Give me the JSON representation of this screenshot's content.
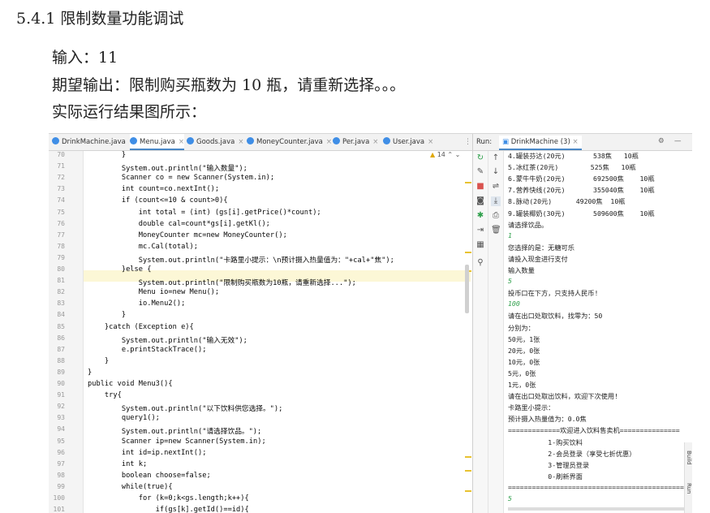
{
  "heading": "5.4.1 限制数量功能调试",
  "input_line": "输入：11",
  "expected_line": "期望输出：限制购买瓶数为 10 瓶，请重新选择。。。",
  "actual_line": "实际运行结果图所示：",
  "ide": {
    "tabs": [
      "DrinkMachine.java",
      "Menu.java",
      "Goods.java",
      "MoneyCounter.java",
      "Per.java",
      "User.java"
    ],
    "active_tab": "Menu.java",
    "more": "⋮",
    "warning_count": "14",
    "run_label": "Run:",
    "run_tab": "DrinkMachine (3)",
    "side_label": "Build",
    "side_label2": "Run",
    "code_lines": [
      {
        "n": "70",
        "t": "        }"
      },
      {
        "n": "71",
        "t": "        System.out.println(\"输入数量\");"
      },
      {
        "n": "72",
        "t": "        Scanner co = new Scanner(System.in);"
      },
      {
        "n": "73",
        "t": "        int count=co.nextInt();"
      },
      {
        "n": "74",
        "t": "        if (count<=10 & count>0){"
      },
      {
        "n": "75",
        "t": "            int total = (int) (gs[i].getPrice()*count);"
      },
      {
        "n": "76",
        "t": "            double cal=count*gs[i].getKl();"
      },
      {
        "n": "77",
        "t": "            MoneyCounter mc=new MoneyCounter();"
      },
      {
        "n": "78",
        "t": "            mc.Cal(total);"
      },
      {
        "n": "79",
        "t": "            System.out.println(\"卡路里小提示：\\n预计摄入热量值为：\"+cal+\"焦\");"
      },
      {
        "n": "80",
        "t": "        }else {"
      },
      {
        "n": "81",
        "t": "            System.out.println(\"限制购买瓶数为10瓶，请重新选择...\");"
      },
      {
        "n": "82",
        "t": "            Menu io=new Menu();"
      },
      {
        "n": "83",
        "t": "            io.Menu2();"
      },
      {
        "n": "84",
        "t": "        }"
      },
      {
        "n": "85",
        "t": "    }catch (Exception e){"
      },
      {
        "n": "86",
        "t": "        System.out.println(\"输入无效\");"
      },
      {
        "n": "87",
        "t": "        e.printStackTrace();"
      },
      {
        "n": "88",
        "t": "    }"
      },
      {
        "n": "89",
        "t": "}"
      },
      {
        "n": "90",
        "t": "public void Menu3(){"
      },
      {
        "n": "91",
        "t": "    try{"
      },
      {
        "n": "92",
        "t": "        System.out.println(\"以下饮料供您选择。\");"
      },
      {
        "n": "93",
        "t": "        query1();"
      },
      {
        "n": "94",
        "t": "        System.out.println(\"请选择饮品。\");"
      },
      {
        "n": "95",
        "t": "        Scanner ip=new Scanner(System.in);"
      },
      {
        "n": "96",
        "t": "        int id=ip.nextInt();"
      },
      {
        "n": "97",
        "t": "        int k;"
      },
      {
        "n": "98",
        "t": "        boolean choose=false;"
      },
      {
        "n": "99",
        "t": "        while(true){"
      },
      {
        "n": "100",
        "t": "            for (k=0;k<gs.length;k++){"
      },
      {
        "n": "101",
        "t": "                if(gs[k].getId()==id){"
      }
    ],
    "output_lines": [
      {
        "t": "4.罐装芬达(20元)       538焦   10瓶",
        "input": false
      },
      {
        "t": "5.冰红茶(20元)        525焦   10瓶",
        "input": false
      },
      {
        "t": "6.蒙牛牛奶(20元)       692500焦    10瓶",
        "input": false
      },
      {
        "t": "7.营养快线(20元)       355040焦    10瓶",
        "input": false
      },
      {
        "t": "8.脉动(20元)      49200焦  10瓶",
        "input": false
      },
      {
        "t": "9.罐装椰奶(30元)       509600焦    10瓶",
        "input": false
      },
      {
        "t": "请选择饮品。",
        "input": false
      },
      {
        "t": "1",
        "input": true
      },
      {
        "t": "您选择的是：无糖可乐",
        "input": false
      },
      {
        "t": "请投入现金进行支付",
        "input": false
      },
      {
        "t": "输入数量",
        "input": false
      },
      {
        "t": "5",
        "input": true
      },
      {
        "t": "投币口在下方，只支持人民币!",
        "input": false
      },
      {
        "t": "100",
        "input": true
      },
      {
        "t": "请在出口处取饮料，找零为：50",
        "input": false
      },
      {
        "t": "分别为：",
        "input": false
      },
      {
        "t": "50元，1张",
        "input": false
      },
      {
        "t": "20元，0张",
        "input": false
      },
      {
        "t": "10元，0张",
        "input": false
      },
      {
        "t": "5元，0张",
        "input": false
      },
      {
        "t": "1元，0张",
        "input": false
      },
      {
        "t": "请在出口处取出饮料，欢迎下次使用!",
        "input": false
      },
      {
        "t": "卡路里小提示：",
        "input": false
      },
      {
        "t": "预计摄入热量值为：0.0焦",
        "input": false
      },
      {
        "t": "=============欢迎进入饮料售卖机===============",
        "input": false
      },
      {
        "t": "          1-购买饮料",
        "input": false
      },
      {
        "t": "          2-会员登录（享受七折优惠）",
        "input": false
      },
      {
        "t": "          3-管理员登录",
        "input": false
      },
      {
        "t": "          0-刷新界面",
        "input": false
      },
      {
        "t": "============================================",
        "input": false
      },
      {
        "t": "5",
        "input": true
      }
    ]
  }
}
